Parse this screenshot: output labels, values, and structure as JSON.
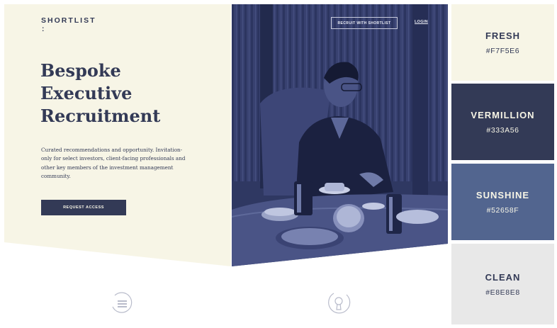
{
  "brand": {
    "name": "SHORTLIST",
    "mark": ":"
  },
  "hero": {
    "title_lines": [
      "Bespoke",
      "Executive",
      "Recruitment"
    ],
    "description": "Curated recommendations and opportunity. Invitation-only for select investors, client-facing professionals and other key members of the investment management community.",
    "cta_label": "REQUEST ACCESS"
  },
  "nav": {
    "recruit_label": "RECRUIT WITH SHORTLIST",
    "login_label": "LOGIN"
  },
  "icons": {
    "left_bottom": "menu-icon",
    "middle_bottom": "lock-icon"
  },
  "palette": [
    {
      "name": "FRESH",
      "hex": "#F7F5E6",
      "text_color": "#333A56"
    },
    {
      "name": "VERMILLION",
      "hex": "#333A56",
      "text_color": "#F7F5E6"
    },
    {
      "name": "SUNSHINE",
      "hex": "#52658F",
      "text_color": "#F7F5E6"
    },
    {
      "name": "CLEAN",
      "hex": "#E8E8E8",
      "text_color": "#333A56"
    }
  ],
  "palette_labels": {
    "0": {
      "name": "FRESH",
      "hex": "#F7F5E6"
    },
    "1": {
      "name": "VERMILLION",
      "hex": "#333A56"
    },
    "2": {
      "name": "SUNSHINE",
      "hex": "#52658F"
    },
    "3": {
      "name": "CLEAN",
      "hex": "#E8E8E8"
    }
  }
}
